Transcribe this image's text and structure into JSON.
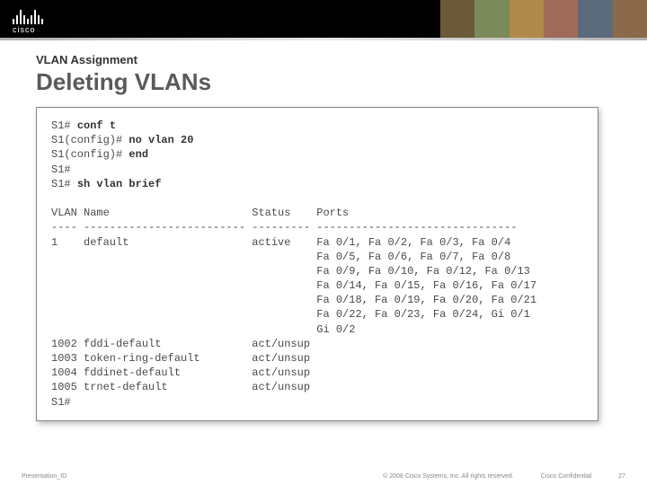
{
  "brand": {
    "logo_text": "cisco"
  },
  "header": {
    "subtitle": "VLAN Assignment",
    "title": "Deleting VLANs"
  },
  "terminal": {
    "lines": [
      {
        "prompt": "S1# ",
        "cmd": "conf t"
      },
      {
        "prompt": "S1(config)# ",
        "cmd": "no vlan 20"
      },
      {
        "prompt": "S1(config)# ",
        "cmd": "end"
      },
      {
        "prompt": "S1#",
        "cmd": ""
      },
      {
        "prompt": "S1# ",
        "cmd": "sh vlan brief"
      }
    ],
    "blank": "",
    "table_header": "VLAN Name                      Status    Ports",
    "table_rule": "---- ------------------------- --------- -------------------------------",
    "vlans": [
      {
        "id": "1",
        "name": "default",
        "status": "active",
        "ports": [
          "Fa 0/1, Fa 0/2, Fa 0/3, Fa 0/4",
          "Fa 0/5, Fa 0/6, Fa 0/7, Fa 0/8",
          "Fa 0/9, Fa 0/10, Fa 0/12, Fa 0/13",
          "Fa 0/14, Fa 0/15, Fa 0/16, Fa 0/17",
          "Fa 0/18, Fa 0/19, Fa 0/20, Fa 0/21",
          "Fa 0/22, Fa 0/23, Fa 0/24, Gi 0/1",
          "Gi 0/2"
        ]
      },
      {
        "id": "1002",
        "name": "fddi-default",
        "status": "act/unsup",
        "ports": []
      },
      {
        "id": "1003",
        "name": "token-ring-default",
        "status": "act/unsup",
        "ports": []
      },
      {
        "id": "1004",
        "name": "fddinet-default",
        "status": "act/unsup",
        "ports": []
      },
      {
        "id": "1005",
        "name": "trnet-default",
        "status": "act/unsup",
        "ports": []
      }
    ],
    "end_prompt": "S1#"
  },
  "footer": {
    "left": "Presentation_ID",
    "copyright": "© 2008 Cisco Systems, Inc. All rights reserved.",
    "confidential": "Cisco Confidential",
    "page": "27"
  }
}
